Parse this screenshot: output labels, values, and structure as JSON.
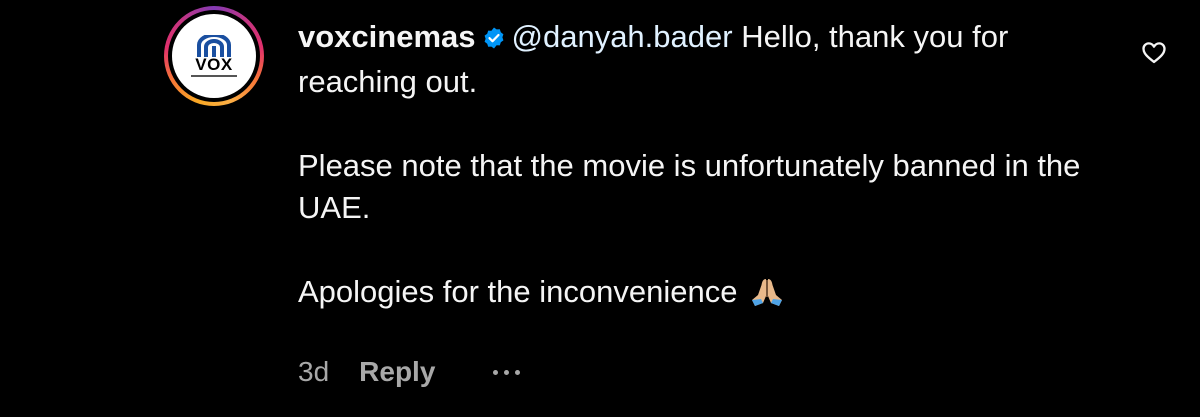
{
  "comment": {
    "author": {
      "username": "voxcinemas",
      "verified": true,
      "avatar_logo_text": "VOX",
      "story_ring": true
    },
    "mention": "@danyah.bader",
    "first_line_text": " Hello, thank you for reaching out.",
    "paragraph_2": "Please note that the movie is unfortunately banned in the UAE.",
    "paragraph_3": "Apologies for the inconvenience",
    "emoji": "folded-hands",
    "timestamp": "3d",
    "reply_label": "Reply",
    "more_icon": "more-horizontal-icon",
    "like_icon": "heart-outline-icon"
  },
  "colors": {
    "background": "#000000",
    "text": "#f5f5f5",
    "mention": "#e0f1ff",
    "secondary": "#a8a8a8",
    "verified_badge": "#0095f6"
  }
}
